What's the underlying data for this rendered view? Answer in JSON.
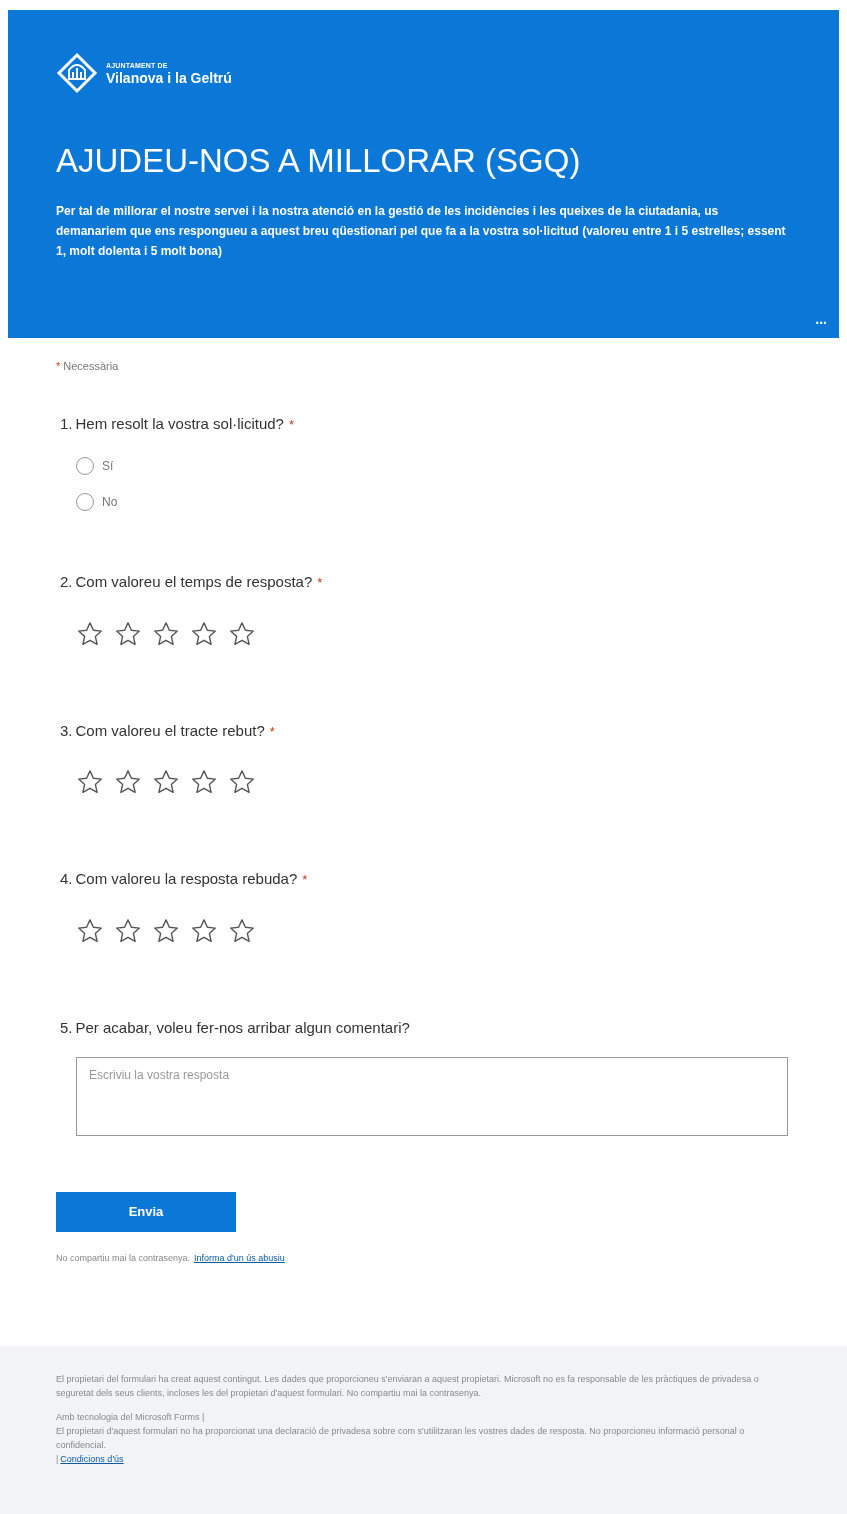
{
  "header": {
    "logo_small": "AJUNTAMENT DE",
    "logo_large": "Vilanova i la Geltrú",
    "title": "AJUDEU-NOS A MILLORAR (SGQ)",
    "description": "Per tal de millorar el nostre servei i la nostra atenció en la gestió de les incidències i les queixes de la ciutadania, us demanariem que ens respongueu a aquest breu qüestionari pel que fa a la vostra sol·licitud (valoreu entre 1 i 5 estrelles; essent 1, molt dolenta i 5 molt bona)",
    "more": "..."
  },
  "required_note": {
    "mark": "*",
    "label": "Necessària"
  },
  "questions": [
    {
      "kind": "radio",
      "number": "1.",
      "text": "Hem resolt la vostra sol·licitud?",
      "required": true,
      "options": [
        {
          "label": "Sí",
          "selected": false
        },
        {
          "label": "No",
          "selected": false
        }
      ]
    },
    {
      "kind": "rating",
      "number": "2.",
      "text": "Com valoreu el temps de resposta?",
      "required": true,
      "stars": 0
    },
    {
      "kind": "rating",
      "number": "3.",
      "text": "Com valoreu el tracte rebut?",
      "required": true,
      "stars": 0
    },
    {
      "kind": "rating",
      "number": "4.",
      "text": "Com valoreu la resposta rebuda?",
      "required": true,
      "stars": 0
    },
    {
      "kind": "text",
      "number": "5.",
      "text": "Per acabar, voleu fer-nos arribar algun comentari?",
      "required": false,
      "placeholder": "Escriviu la vostra resposta"
    }
  ],
  "submit": {
    "label": "Envia",
    "note": "No compartiu mai la contrasenya.",
    "link": "Informa d'un ús abusiu"
  },
  "footer": {
    "disclaimer": "El propietari del formulari ha creat aquest contingut. Les dades que proporcioneu s'enviaran a aquest propietari. Microsoft no es fa responsable de les pràctiques de privadesa o seguretat dels seus clients, incloses les del propietari d'aquest formulari. No compartiu mai la contrasenya.",
    "powered": "Amb tecnologia del Microsoft Forms |",
    "privacy": "El propietari d'aquest formulari no ha proporcionat una declaració de privadesa sobre com s'utilitzaran les vostres dades de resposta. No proporcioneu informació personal o confidencial.",
    "terms_sep": "|",
    "terms": "Condicions d'ús"
  }
}
